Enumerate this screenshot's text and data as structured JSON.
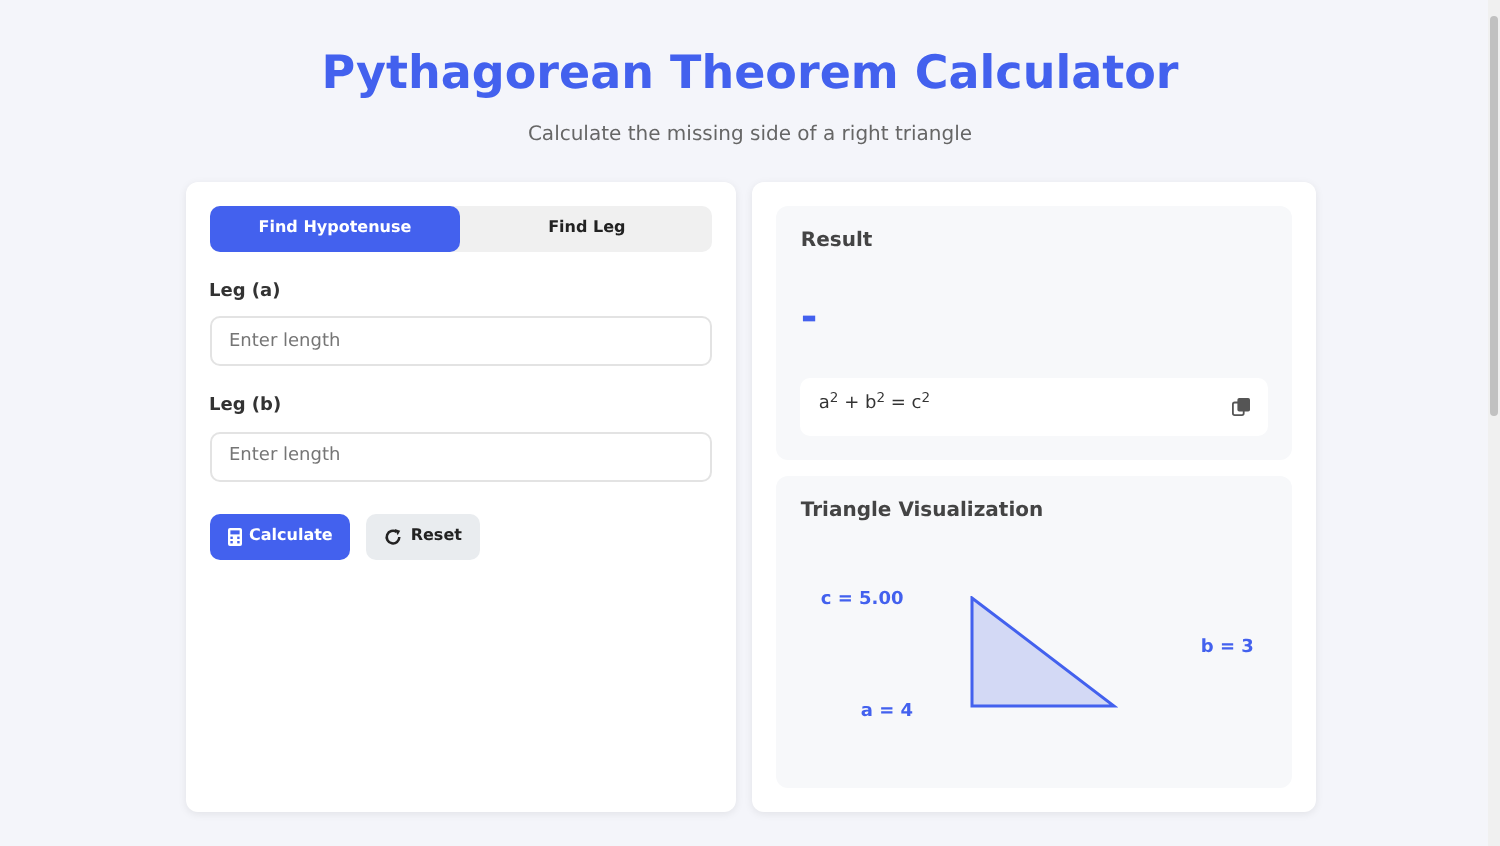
{
  "header": {
    "title": "Pythagorean Theorem Calculator",
    "subtitle": "Calculate the missing side of a right triangle"
  },
  "tabs": [
    {
      "label": "Find Hypotenuse",
      "selected": true
    },
    {
      "label": "Find Leg",
      "selected": false
    }
  ],
  "fields": [
    {
      "label": "Leg (a)",
      "placeholder": "Enter length"
    },
    {
      "label": "Leg (b)",
      "placeholder": "Enter length"
    }
  ],
  "buttons": [
    {
      "kind": "primary",
      "label": "Calculate"
    },
    {
      "kind": "secondary",
      "label": "Reset"
    }
  ],
  "result": {
    "title": "Result",
    "value": "-",
    "formula": "a$^{2}$ + b$^{2}$ = c$^{2}$"
  },
  "visualization": {
    "title": "Triangle Visualization",
    "labels": [
      {
        "text": "c = 5.00"
      },
      {
        "text": "b = 3"
      },
      {
        "text": "a = 4"
      }
    ]
  }
}
